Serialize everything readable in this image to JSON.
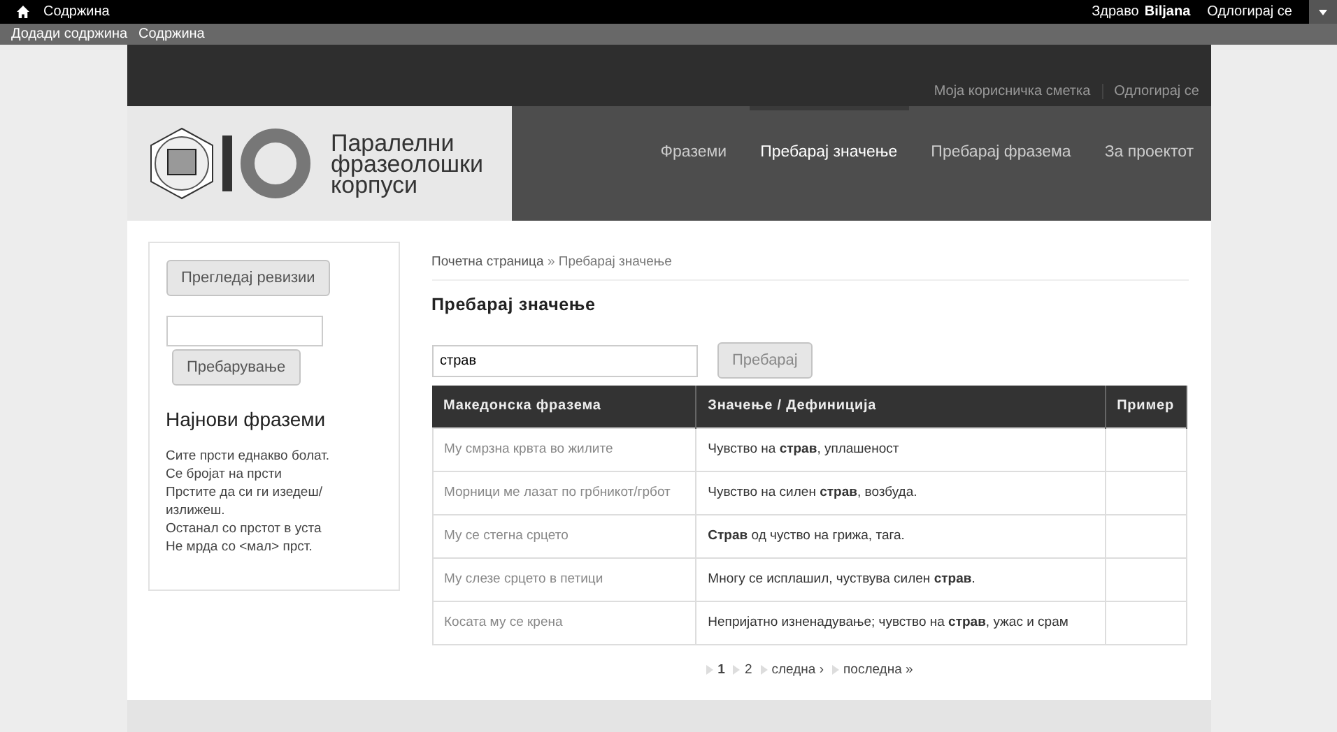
{
  "admin_toolbar": {
    "home_label": "Содржина",
    "greeting": "Здраво",
    "user": "Biljana",
    "logout": "Одлогирај се",
    "shortcuts": [
      "Додади содржина",
      "Содржина"
    ]
  },
  "site": {
    "top_links": [
      "Моја корисничка сметка",
      "Одлогирај се"
    ],
    "site_name": [
      "Паралелни",
      "фразеолошки",
      "корпуси"
    ],
    "nav": [
      {
        "label": "Фраземи",
        "selected": false
      },
      {
        "label": "Пребарај значење",
        "selected": true
      },
      {
        "label": "Пребарај фразема",
        "selected": false
      },
      {
        "label": "За проектот",
        "selected": false
      }
    ]
  },
  "sidebar": {
    "revisions_button": "Прегледај ревизии",
    "search_button": "Пребарување",
    "heading": "Најнови фраземи",
    "items": [
      "Сите прсти еднакво болат.",
      "Се бројат на прсти",
      "Прстите да си ги изедеш/излижеш.",
      "Останал со прстот в уста",
      "Не мрда со <мал> прст."
    ]
  },
  "breadcrumb": {
    "home": "Почетна страница",
    "separator": "»",
    "current": "Пребарај значење"
  },
  "title": "Пребарај значење",
  "search": {
    "value": "страв",
    "button": "Пребарај"
  },
  "table": {
    "columns": [
      "Македонска фразема",
      "Значење / Дефиниција",
      "Пример"
    ],
    "rows": [
      [
        "Му смрзна крвта во жилите",
        "Чувство на **страв**, уплашеност",
        ""
      ],
      [
        "Морници ме лазат по грбникот/грбот",
        "Чувство на силен **страв**, возбуда.",
        ""
      ],
      [
        "Му се стегна срцето",
        "**Страв** од чуство на грижа, тага.",
        ""
      ],
      [
        "Му слезе срцето в петици",
        "Многу се исплашил, чуствува силен **страв**.",
        ""
      ],
      [
        "Косата му се крена",
        "Непријатно изненадување; чувство на **страв**, ужас и срам",
        ""
      ]
    ]
  },
  "pager": [
    {
      "label": "1",
      "selected": true
    },
    {
      "label": "2",
      "selected": false
    },
    {
      "label": "следна ›",
      "selected": false
    },
    {
      "label": "последна »",
      "selected": false
    }
  ]
}
